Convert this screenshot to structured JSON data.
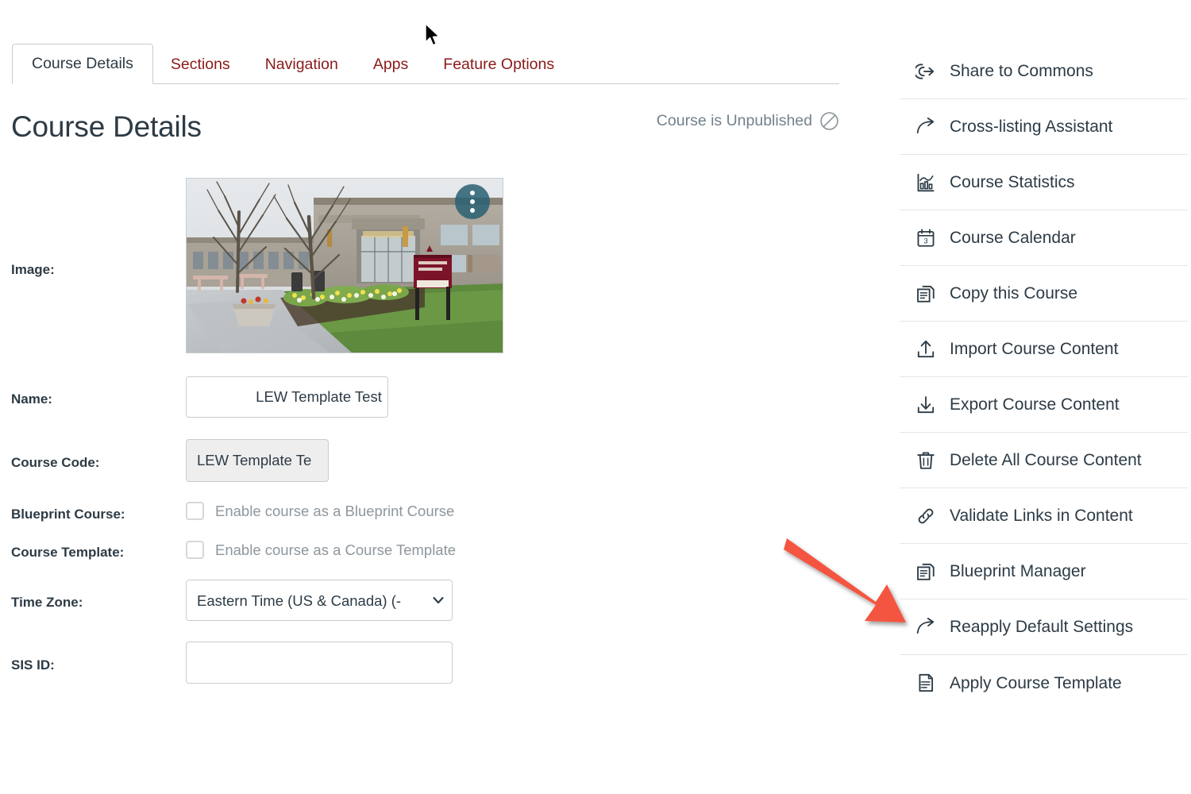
{
  "tabs": [
    {
      "label": "Course Details",
      "active": true
    },
    {
      "label": "Sections",
      "active": false
    },
    {
      "label": "Navigation",
      "active": false
    },
    {
      "label": "Apps",
      "active": false
    },
    {
      "label": "Feature Options",
      "active": false
    }
  ],
  "page": {
    "title": "Course Details",
    "publish_status": "Course is Unpublished"
  },
  "form": {
    "image_label": "Image:",
    "name_label": "Name:",
    "name_value": "LEW Template Test ",
    "course_code_label": "Course Code:",
    "course_code_value": "LEW Template Te",
    "blueprint_label": "Blueprint Course:",
    "blueprint_checkbox_label": "Enable course as a Blueprint Course",
    "template_label": "Course Template:",
    "template_checkbox_label": "Enable course as a Course Template",
    "timezone_label": "Time Zone:",
    "timezone_value": "Eastern Time (US & Canada) (-",
    "sis_id_label": "SIS ID:",
    "sis_id_value": "",
    "image_menu_name": "kebab-menu-button"
  },
  "sidebar": {
    "items": [
      {
        "label": "Share to Commons",
        "icon": "share-commons-icon"
      },
      {
        "label": "Cross-listing Assistant",
        "icon": "arrow-curve-right-icon"
      },
      {
        "label": "Course Statistics",
        "icon": "bar-chart-icon"
      },
      {
        "label": "Course Calendar",
        "icon": "calendar-icon"
      },
      {
        "label": "Copy this Course",
        "icon": "copy-document-icon"
      },
      {
        "label": "Import Course Content",
        "icon": "upload-arrow-icon"
      },
      {
        "label": "Export Course Content",
        "icon": "download-arrow-icon"
      },
      {
        "label": "Delete All Course Content",
        "icon": "trash-icon"
      },
      {
        "label": "Validate Links in Content",
        "icon": "link-chain-icon"
      },
      {
        "label": "Blueprint Manager",
        "icon": "copy-document-icon"
      },
      {
        "label": "Reapply Default Settings",
        "icon": "arrow-curve-right-icon"
      },
      {
        "label": "Apply Course Template",
        "icon": "document-lines-icon"
      }
    ]
  },
  "colors": {
    "link_crimson": "#8B1A1A",
    "text_dark": "#2D3B45",
    "muted_text": "#73818C",
    "border": "#C7CDD1",
    "annotation_arrow": "#F4553F",
    "kebab_teal": "#2A6172"
  },
  "annotation": {
    "arrow_points_to": "Reapply Default Settings"
  }
}
